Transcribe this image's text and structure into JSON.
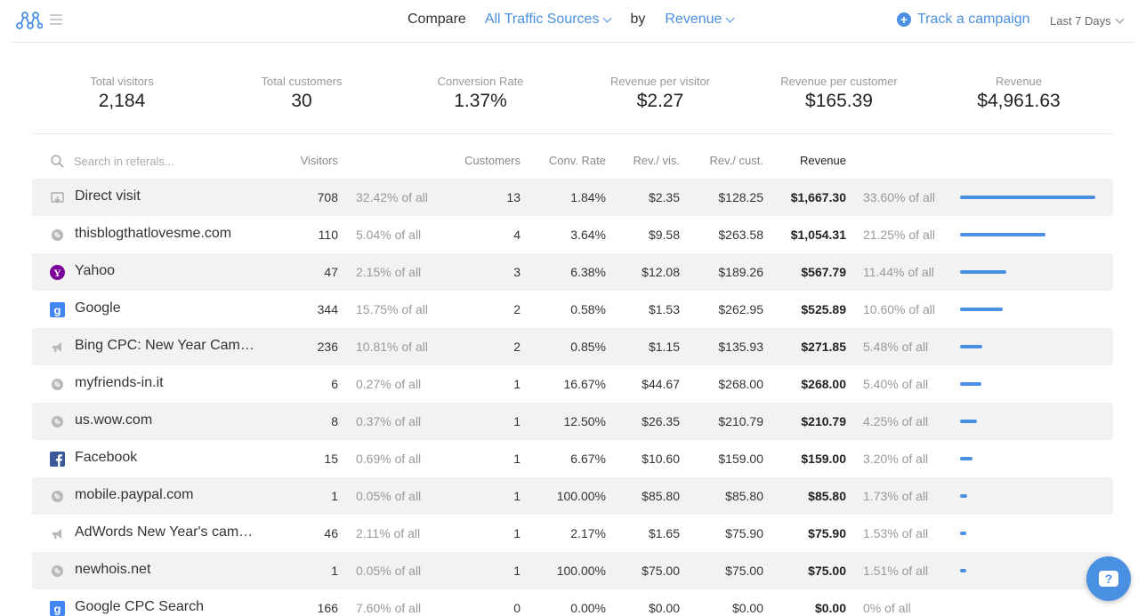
{
  "header": {
    "compare_label": "Compare",
    "compare_value": "All Traffic Sources",
    "by_label": "by",
    "by_value": "Revenue",
    "track_label": "Track a campaign",
    "date_range": "Last 7 Days"
  },
  "stats": [
    {
      "label": "Total visitors",
      "value": "2,184"
    },
    {
      "label": "Total customers",
      "value": "30"
    },
    {
      "label": "Conversion Rate",
      "value": "1.37%"
    },
    {
      "label": "Revenue per visitor",
      "value": "$2.27"
    },
    {
      "label": "Revenue per customer",
      "value": "$165.39"
    },
    {
      "label": "Revenue",
      "value": "$4,961.63"
    }
  ],
  "table": {
    "search_placeholder": "Search in referals...",
    "columns": {
      "visitors": "Visitors",
      "customers": "Customers",
      "conv_rate": "Conv. Rate",
      "rev_vis": "Rev./ vis.",
      "rev_cust": "Rev./ cust.",
      "revenue": "Revenue"
    },
    "rows": [
      {
        "icon": "direct-visit-icon",
        "name": "Direct visit",
        "visitors": "708",
        "visitors_pct": "32.42% of all",
        "customers": "13",
        "conv": "1.84%",
        "rev_vis": "$2.35",
        "rev_cust": "$128.25",
        "revenue": "$1,667.30",
        "revenue_pct": "33.60% of all",
        "share": 0.336
      },
      {
        "icon": "globe-icon",
        "name": "thisblogthatlovesme.com",
        "visitors": "110",
        "visitors_pct": "5.04% of all",
        "customers": "4",
        "conv": "3.64%",
        "rev_vis": "$9.58",
        "rev_cust": "$263.58",
        "revenue": "$1,054.31",
        "revenue_pct": "21.25% of all",
        "share": 0.2125
      },
      {
        "icon": "yahoo-icon",
        "name": "Yahoo",
        "visitors": "47",
        "visitors_pct": "2.15% of all",
        "customers": "3",
        "conv": "6.38%",
        "rev_vis": "$12.08",
        "rev_cust": "$189.26",
        "revenue": "$567.79",
        "revenue_pct": "11.44% of all",
        "share": 0.1144
      },
      {
        "icon": "google-icon",
        "name": "Google",
        "visitors": "344",
        "visitors_pct": "15.75% of all",
        "customers": "2",
        "conv": "0.58%",
        "rev_vis": "$1.53",
        "rev_cust": "$262.95",
        "revenue": "$525.89",
        "revenue_pct": "10.60% of all",
        "share": 0.106
      },
      {
        "icon": "megaphone-icon",
        "name": "Bing CPC: New Year Cam…",
        "visitors": "236",
        "visitors_pct": "10.81% of all",
        "customers": "2",
        "conv": "0.85%",
        "rev_vis": "$1.15",
        "rev_cust": "$135.93",
        "revenue": "$271.85",
        "revenue_pct": "5.48% of all",
        "share": 0.0548
      },
      {
        "icon": "globe-icon",
        "name": "myfriends-in.it",
        "visitors": "6",
        "visitors_pct": "0.27% of all",
        "customers": "1",
        "conv": "16.67%",
        "rev_vis": "$44.67",
        "rev_cust": "$268.00",
        "revenue": "$268.00",
        "revenue_pct": "5.40% of all",
        "share": 0.054
      },
      {
        "icon": "globe-icon",
        "name": "us.wow.com",
        "visitors": "8",
        "visitors_pct": "0.37% of all",
        "customers": "1",
        "conv": "12.50%",
        "rev_vis": "$26.35",
        "rev_cust": "$210.79",
        "revenue": "$210.79",
        "revenue_pct": "4.25% of all",
        "share": 0.0425
      },
      {
        "icon": "facebook-icon",
        "name": "Facebook",
        "visitors": "15",
        "visitors_pct": "0.69% of all",
        "customers": "1",
        "conv": "6.67%",
        "rev_vis": "$10.60",
        "rev_cust": "$159.00",
        "revenue": "$159.00",
        "revenue_pct": "3.20% of all",
        "share": 0.032
      },
      {
        "icon": "globe-icon",
        "name": "mobile.paypal.com",
        "visitors": "1",
        "visitors_pct": "0.05% of all",
        "customers": "1",
        "conv": "100.00%",
        "rev_vis": "$85.80",
        "rev_cust": "$85.80",
        "revenue": "$85.80",
        "revenue_pct": "1.73% of all",
        "share": 0.0173
      },
      {
        "icon": "megaphone-icon",
        "name": "AdWords New Year's cam…",
        "visitors": "46",
        "visitors_pct": "2.11% of all",
        "customers": "1",
        "conv": "2.17%",
        "rev_vis": "$1.65",
        "rev_cust": "$75.90",
        "revenue": "$75.90",
        "revenue_pct": "1.53% of all",
        "share": 0.0153
      },
      {
        "icon": "globe-icon",
        "name": "newhois.net",
        "visitors": "1",
        "visitors_pct": "0.05% of all",
        "customers": "1",
        "conv": "100.00%",
        "rev_vis": "$75.00",
        "rev_cust": "$75.00",
        "revenue": "$75.00",
        "revenue_pct": "1.51% of all",
        "share": 0.0151
      },
      {
        "icon": "google-icon",
        "name": "Google CPC Search",
        "visitors": "166",
        "visitors_pct": "7.60% of all",
        "customers": "0",
        "conv": "0.00%",
        "rev_vis": "$0.00",
        "rev_cust": "$0.00",
        "revenue": "$0.00",
        "revenue_pct": "0% of all",
        "share": 0
      }
    ]
  },
  "colors": {
    "accent": "#4a90e2",
    "row_alt": "#f2f2f2",
    "yahoo": "#7b0099",
    "google": "#4285f4",
    "facebook": "#3b5998"
  },
  "chat_icon": "chat-help-icon"
}
